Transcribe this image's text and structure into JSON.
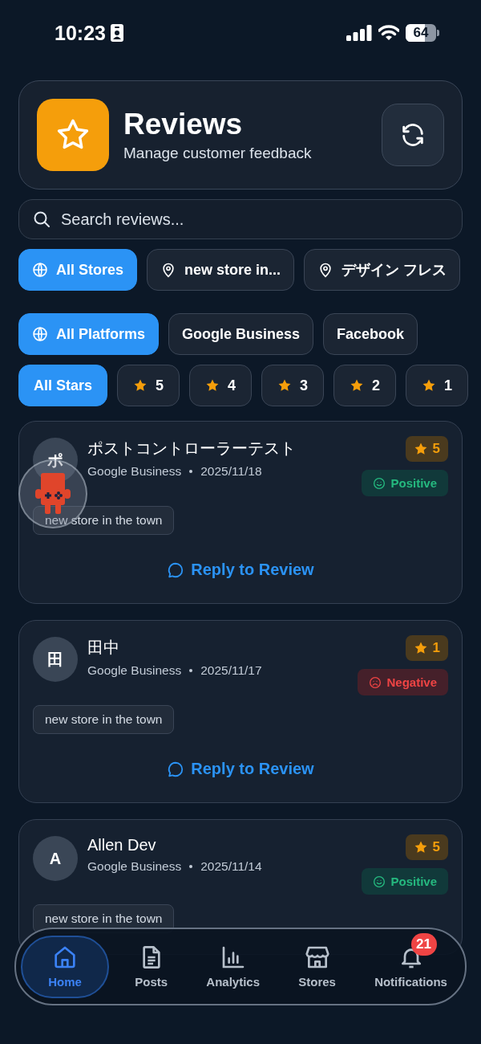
{
  "status_bar": {
    "time": "10:23",
    "battery": "64"
  },
  "header": {
    "title": "Reviews",
    "subtitle": "Manage customer feedback"
  },
  "search": {
    "placeholder": "Search reviews..."
  },
  "stores": [
    {
      "label": "All Stores",
      "kind": "all",
      "selected": true
    },
    {
      "label": "new store in...",
      "kind": "store",
      "selected": false
    },
    {
      "label": "デザイン フレス",
      "kind": "store",
      "selected": false
    }
  ],
  "platforms": [
    {
      "label": "All Platforms",
      "kind": "all",
      "selected": true
    },
    {
      "label": "Google Business",
      "kind": "platform",
      "selected": false
    },
    {
      "label": "Facebook",
      "kind": "platform",
      "selected": false
    }
  ],
  "star_filters": [
    {
      "label": "All Stars",
      "kind": "all",
      "selected": true
    },
    {
      "label": "5",
      "kind": "star",
      "selected": false
    },
    {
      "label": "4",
      "kind": "star",
      "selected": false
    },
    {
      "label": "3",
      "kind": "star",
      "selected": false
    },
    {
      "label": "2",
      "kind": "star",
      "selected": false
    },
    {
      "label": "1",
      "kind": "star",
      "selected": false
    }
  ],
  "reviews": [
    {
      "initial": "ポ",
      "name": "ポストコントローラーテスト",
      "platform": "Google Business",
      "date": "2025/11/18",
      "rating": "5",
      "sentiment": {
        "kind": "positive",
        "label": "Positive"
      },
      "tag": "new store in the town",
      "reply": "Reply to Review"
    },
    {
      "initial": "田",
      "name": "田中",
      "platform": "Google Business",
      "date": "2025/11/17",
      "rating": "1",
      "sentiment": {
        "kind": "negative",
        "label": "Negative"
      },
      "tag": "new store in the town",
      "reply": "Reply to Review"
    },
    {
      "initial": "A",
      "name": "Allen Dev",
      "platform": "Google Business",
      "date": "2025/11/14",
      "rating": "5",
      "sentiment": {
        "kind": "positive",
        "label": "Positive"
      },
      "tag": "new store in the town"
    }
  ],
  "nav": [
    {
      "label": "Home",
      "kind": "home",
      "selected": true
    },
    {
      "label": "Posts",
      "kind": "posts",
      "selected": false
    },
    {
      "label": "Analytics",
      "kind": "analytics",
      "selected": false
    },
    {
      "label": "Stores",
      "kind": "stores",
      "selected": false
    },
    {
      "label": "Notifications",
      "kind": "notifications",
      "selected": false,
      "badge": "21"
    }
  ]
}
